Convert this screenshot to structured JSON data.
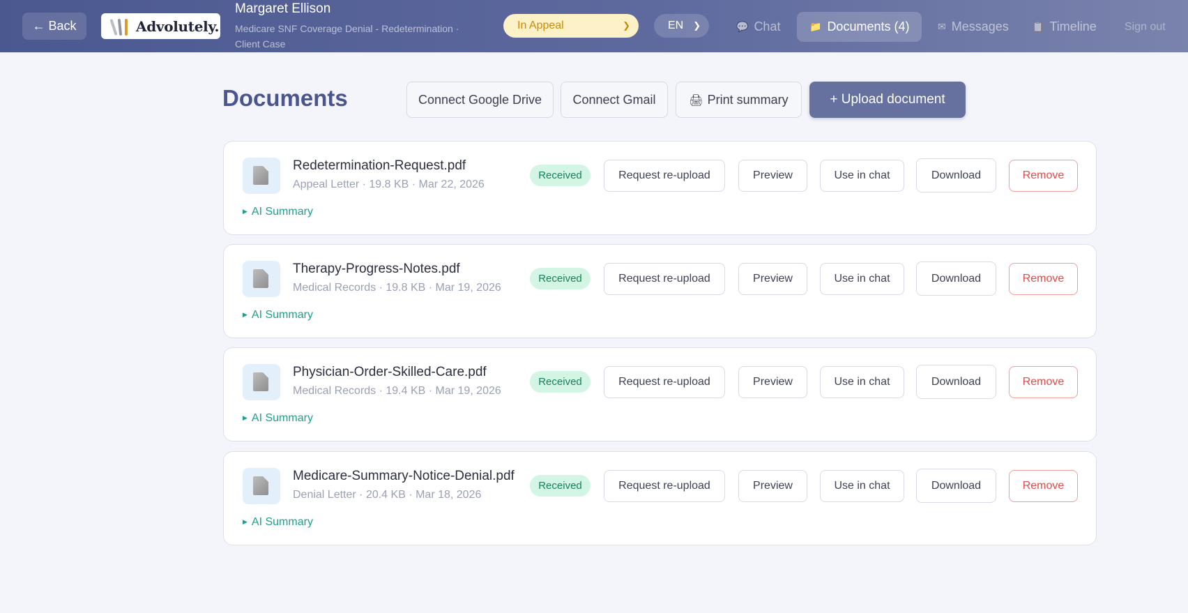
{
  "header": {
    "back_label": "← Back",
    "logo_text": "Advolutely.",
    "client_name": "Margaret Ellison",
    "case_subtitle": "Medicare SNF Coverage Denial - Redetermination · Client Case",
    "status_value": "In Appeal",
    "language_value": "EN",
    "nav": {
      "chat": "Chat",
      "documents": "Documents (4)",
      "messages": "Messages",
      "timeline": "Timeline",
      "signout": "Sign out"
    },
    "icons": {
      "chat": "💬",
      "documents": "📁",
      "messages": "✉",
      "timeline": "📋"
    }
  },
  "toolbar": {
    "title": "Documents",
    "connect_drive": "Connect Google Drive",
    "connect_gmail": "Connect Gmail",
    "print_summary": "Print summary",
    "print_icon": "🖨",
    "upload": "+ Upload document"
  },
  "actions": {
    "request_reupload": "Request re-upload",
    "preview": "Preview",
    "use_in_chat": "Use in chat",
    "download": "Download",
    "remove": "Remove"
  },
  "documents": [
    {
      "name": "Redetermination-Request.pdf",
      "meta": "Appeal Letter · 19.8 KB · Mar 22, 2026",
      "status": "Received",
      "summary_label": "AI Summary"
    },
    {
      "name": "Therapy-Progress-Notes.pdf",
      "meta": "Medical Records · 19.8 KB · Mar 19, 2026",
      "status": "Received",
      "summary_label": "AI Summary"
    },
    {
      "name": "Physician-Order-Skilled-Care.pdf",
      "meta": "Medical Records · 19.4 KB · Mar 19, 2026",
      "status": "Received",
      "summary_label": "AI Summary"
    },
    {
      "name": "Medicare-Summary-Notice-Denial.pdf",
      "meta": "Denial Letter · 20.4 KB · Mar 18, 2026",
      "status": "Received",
      "summary_label": "AI Summary"
    }
  ],
  "colors": {
    "header_gradient_start": "#4b5890",
    "accent": "#67719f",
    "title": "#4a5590",
    "status_badge": "#d3f5e4",
    "appeal_pill": "#fdf1c7",
    "summary_link": "#1f9e8c",
    "remove": "#e24a4a"
  }
}
